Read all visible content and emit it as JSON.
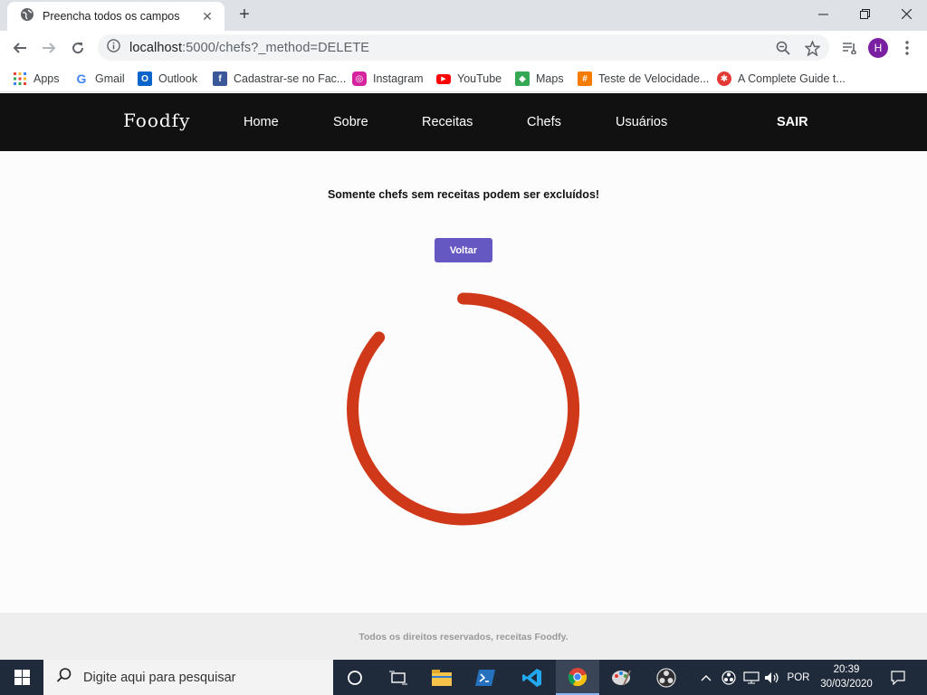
{
  "browser": {
    "tab_title": "Preencha todos os campos",
    "new_tab_symbol": "+",
    "url_host": "localhost",
    "url_rest": ":5000/chefs?_method=DELETE",
    "profile_initial": "H",
    "bookmarks": [
      "Apps",
      "Gmail",
      "Outlook",
      "Cadastrar-se no Fac...",
      "Instagram",
      "YouTube",
      "Maps",
      "Teste de Velocidade...",
      "A Complete Guide t..."
    ]
  },
  "site": {
    "logo": "Foodfy",
    "nav": [
      "Home",
      "Sobre",
      "Receitas",
      "Chefs",
      "Usuários"
    ],
    "logout": "SAIR",
    "message": "Somente chefs sem receitas podem ser excluídos!",
    "back_button": "Voltar",
    "footer": "Todos os direitos reservados, receitas Foodfy.",
    "spinner_color": "#d0381a",
    "button_color": "#6558c2"
  },
  "taskbar": {
    "search_placeholder": "Digite aqui para pesquisar",
    "language": "POR",
    "time": "20:39",
    "date": "30/03/2020"
  }
}
